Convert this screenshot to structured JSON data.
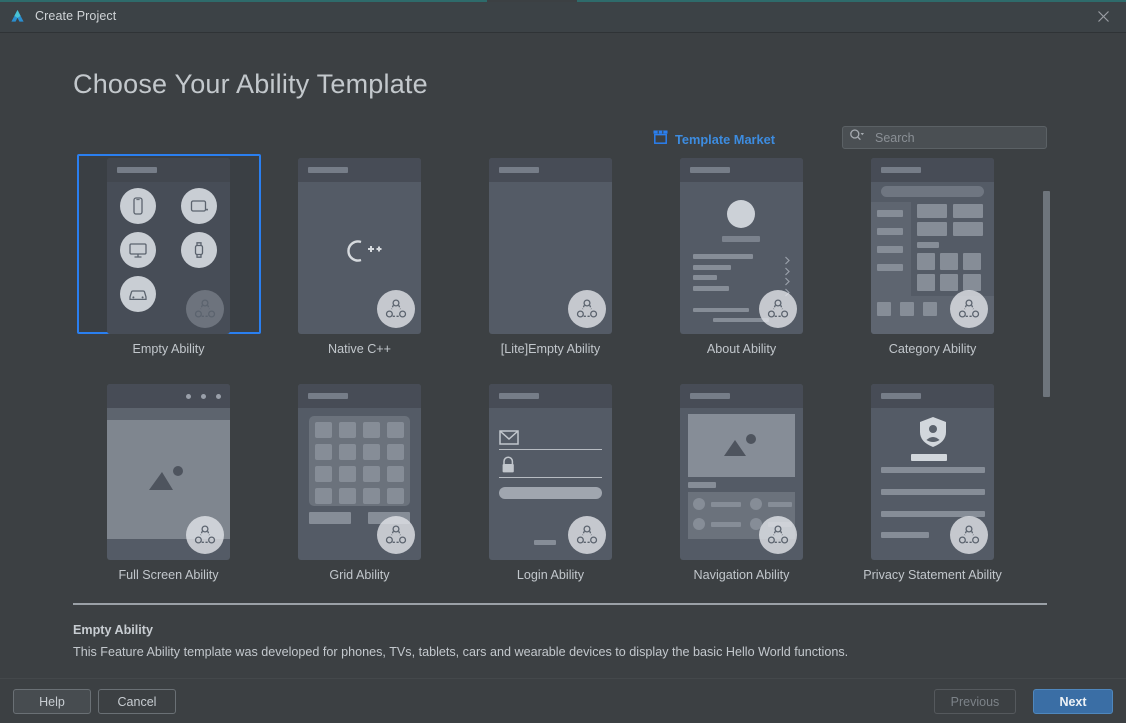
{
  "window": {
    "title": "Create Project",
    "logo_icon": "harmony-logo-icon",
    "close_icon": "close-icon"
  },
  "page": {
    "title": "Choose Your Ability Template"
  },
  "toolbar": {
    "market_link_label": "Template Market",
    "market_icon": "store-icon",
    "search_icon": "search-dropdown-icon",
    "search_placeholder": "Search",
    "search_value": ""
  },
  "colors": {
    "accent_blue": "#2a7ff0",
    "link_blue": "#3d8ce0",
    "primary_button": "#3a6ea5",
    "background": "#3c4043",
    "card_body": "#545b66",
    "card_header": "#474c56"
  },
  "templates": [
    {
      "label": "Empty Ability",
      "mock": "devices",
      "selected": true,
      "badge_icon": "feature-ability-badge-icon"
    },
    {
      "label": "Native C++",
      "mock": "cpp",
      "selected": false,
      "badge_icon": "feature-ability-badge-icon",
      "logo_text": "C++"
    },
    {
      "label": "[Lite]Empty Ability",
      "mock": "blank",
      "selected": false,
      "badge_icon": "feature-ability-badge-icon"
    },
    {
      "label": "About Ability",
      "mock": "about",
      "selected": false,
      "badge_icon": "feature-ability-badge-icon"
    },
    {
      "label": "Category Ability",
      "mock": "category",
      "selected": false,
      "badge_icon": "feature-ability-badge-icon"
    },
    {
      "label": "Full Screen Ability",
      "mock": "fullscreen",
      "selected": false,
      "badge_icon": "feature-ability-badge-icon"
    },
    {
      "label": "Grid Ability",
      "mock": "grid",
      "selected": false,
      "badge_icon": "feature-ability-badge-icon"
    },
    {
      "label": "Login Ability",
      "mock": "login",
      "selected": false,
      "badge_icon": "feature-ability-badge-icon"
    },
    {
      "label": "Navigation Ability",
      "mock": "navigation",
      "selected": false,
      "badge_icon": "feature-ability-badge-icon"
    },
    {
      "label": "Privacy Statement Ability",
      "mock": "privacy",
      "selected": false,
      "badge_icon": "feature-ability-badge-icon"
    }
  ],
  "description": {
    "title": "Empty Ability",
    "text": "This Feature Ability template was developed for phones, TVs, tablets, cars and wearable devices to display the basic Hello World functions."
  },
  "footer": {
    "help_label": "Help",
    "cancel_label": "Cancel",
    "previous_label": "Previous",
    "previous_disabled": true,
    "next_label": "Next"
  },
  "scrollbar": {
    "orientation": "vertical",
    "thumb_position_percent": 0,
    "thumb_size_percent": 52
  }
}
